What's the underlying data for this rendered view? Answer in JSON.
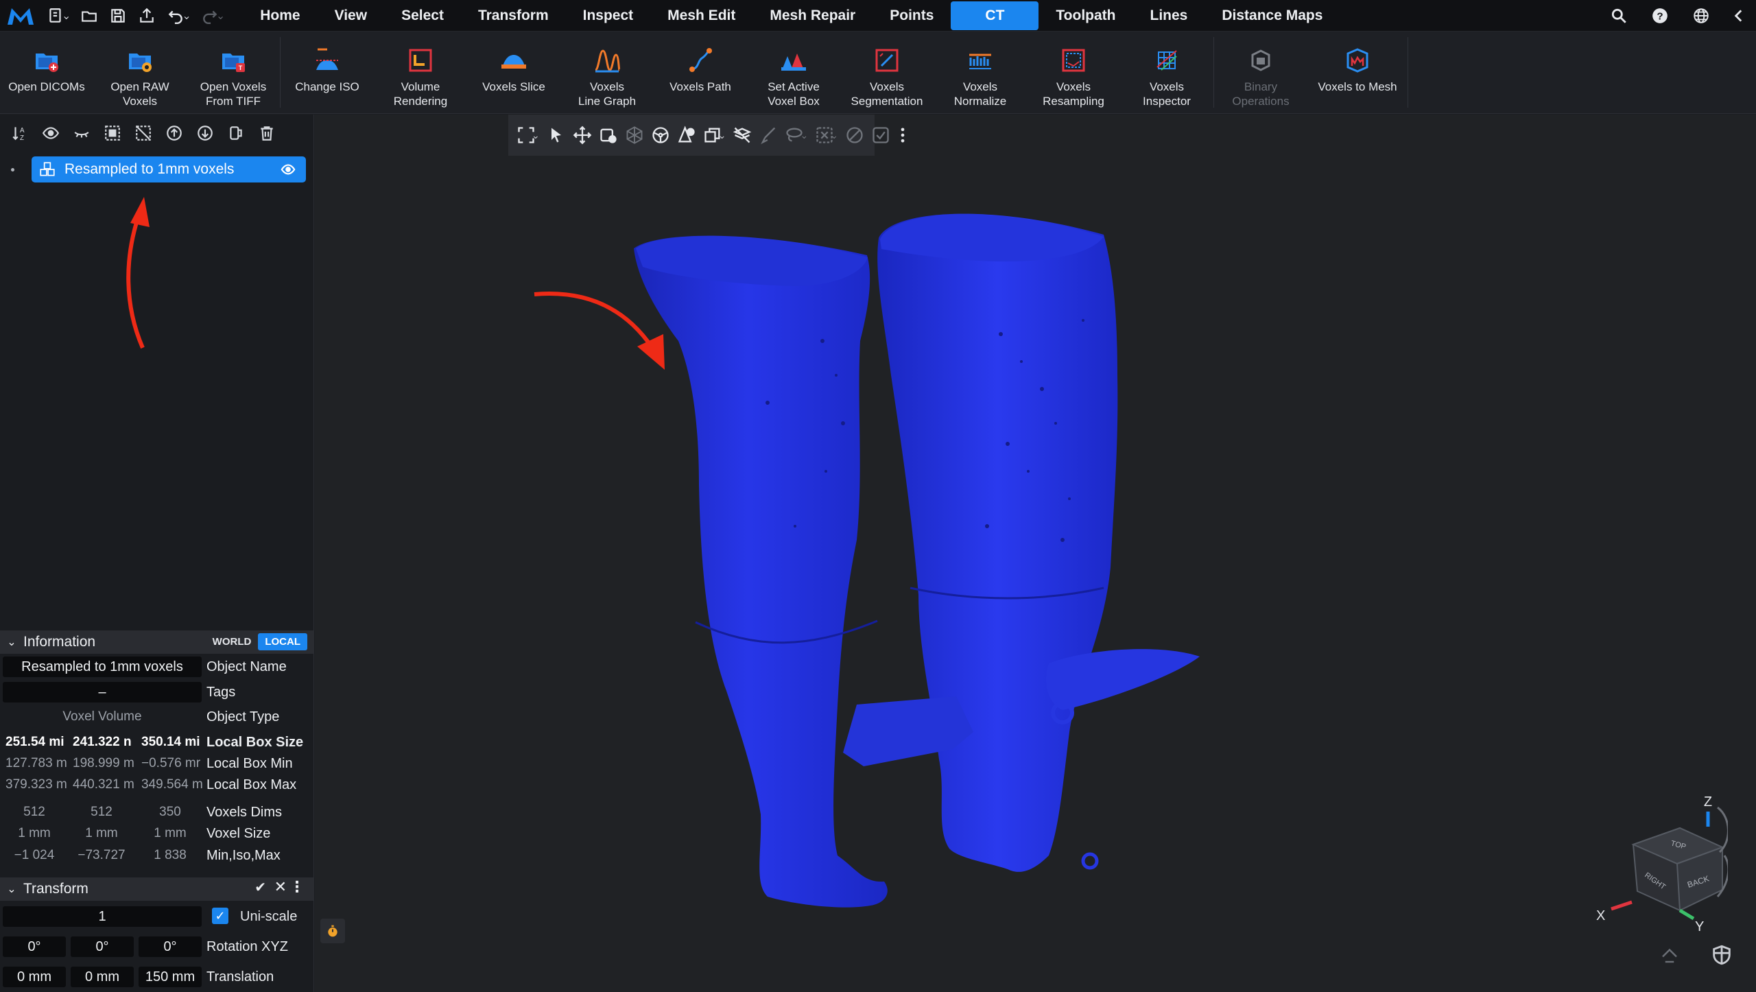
{
  "menu": {
    "tabs": [
      {
        "label": "Home"
      },
      {
        "label": "View"
      },
      {
        "label": "Select"
      },
      {
        "label": "Transform"
      },
      {
        "label": "Inspect"
      },
      {
        "label": "Mesh Edit"
      },
      {
        "label": "Mesh Repair"
      },
      {
        "label": "Points"
      },
      {
        "label": "CT"
      },
      {
        "label": "Toolpath"
      },
      {
        "label": "Lines"
      },
      {
        "label": "Distance Maps"
      }
    ],
    "active": "CT"
  },
  "ribbon": {
    "open_dicoms": "Open DICOMs",
    "open_raw_1": "Open RAW",
    "open_raw_2": "Voxels",
    "open_tiff_1": "Open Voxels",
    "open_tiff_2": "From TIFF",
    "change_iso": "Change ISO",
    "volume_rendering_1": "Volume",
    "volume_rendering_2": "Rendering",
    "voxels_slice": "Voxels Slice",
    "line_graph_1": "Voxels",
    "line_graph_2": "Line Graph",
    "voxels_path": "Voxels Path",
    "voxel_box_1": "Set Active",
    "voxel_box_2": "Voxel Box",
    "segmentation_1": "Voxels",
    "segmentation_2": "Segmentation",
    "normalize_1": "Voxels",
    "normalize_2": "Normalize",
    "resampling_1": "Voxels",
    "resampling_2": "Resampling",
    "inspector_1": "Voxels",
    "inspector_2": "Inspector",
    "binary_1": "Binary",
    "binary_2": "Operations",
    "voxels_to_mesh": "Voxels to Mesh"
  },
  "tree": {
    "object_label": "Resampled to 1mm voxels"
  },
  "information": {
    "title": "Information",
    "world": "WORLD",
    "local": "LOCAL",
    "object_name_value": "Resampled to 1mm voxels",
    "object_name_label": "Object Name",
    "tags_value": "–",
    "tags_label": "Tags",
    "object_type_value": "Voxel Volume",
    "object_type_label": "Object Type",
    "box_size": [
      "251.54 mi",
      "241.322 n",
      "350.14 mi"
    ],
    "box_size_label": "Local Box Size",
    "box_min": [
      "127.783 m",
      "198.999 m",
      "−0.576 mr"
    ],
    "box_min_label": "Local Box Min",
    "box_max": [
      "379.323 m",
      "440.321 m",
      "349.564 m"
    ],
    "box_max_label": "Local Box Max",
    "dims": [
      "512",
      "512",
      "350"
    ],
    "dims_label": "Voxels Dims",
    "voxel_size": [
      "1 mm",
      "1 mm",
      "1 mm"
    ],
    "voxel_size_label": "Voxel Size",
    "min_iso_max": [
      "−1 024",
      "−73.727",
      "1 838"
    ],
    "min_iso_max_label": "Min,Iso,Max"
  },
  "transform": {
    "title": "Transform",
    "scale_value": "1",
    "uniscale_label": "Uni-scale",
    "rotation": [
      "0°",
      "0°",
      "0°"
    ],
    "rotation_label": "Rotation XYZ",
    "translation": [
      "0 mm",
      "0 mm",
      "150 mm"
    ],
    "translation_label": "Translation"
  },
  "view_cube": {
    "axis_z": "Z",
    "axis_x": "X",
    "axis_y": "Y",
    "face_top": "TOP",
    "face_right": "RIGHT",
    "face_back": "BACK"
  },
  "colors": {
    "accent": "#1b86ef",
    "model": "#1f2fe0",
    "arrow": "#ee2a16",
    "menubar": "#101114",
    "panel": "#1a1c20",
    "viewport": "#202225"
  }
}
